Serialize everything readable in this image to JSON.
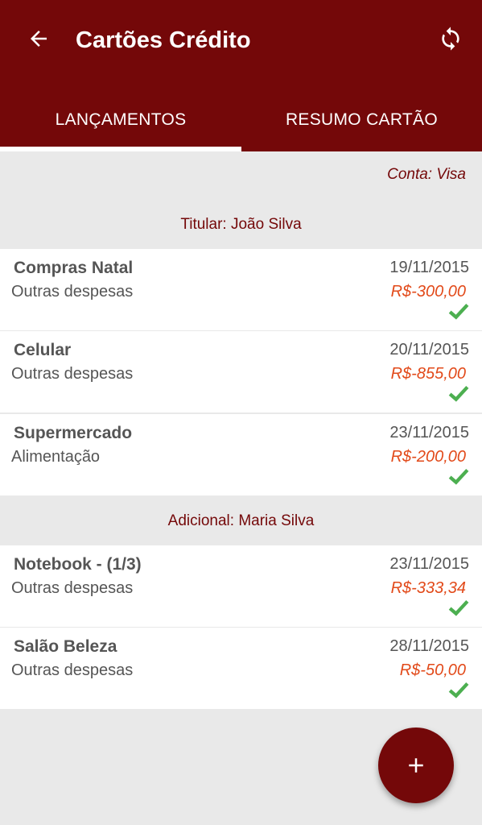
{
  "appbar": {
    "title": "Cartões Crédito",
    "back_icon": "arrow-back-icon",
    "sync_icon": "sync-icon"
  },
  "tabs": [
    {
      "label": "LANÇAMENTOS",
      "active": true
    },
    {
      "label": "RESUMO CARTÃO",
      "active": false
    }
  ],
  "account": "Conta: Visa",
  "groups": [
    {
      "header": "Titular: João Silva",
      "items": [
        {
          "name": "Compras Natal",
          "category": "Outras despesas",
          "date": "19/11/2015",
          "amount": "R$-300,00",
          "status_icon": "check-icon"
        },
        {
          "name": "Celular",
          "category": "Outras despesas",
          "date": "20/11/2015",
          "amount": "R$-855,00",
          "status_icon": "check-icon"
        },
        {
          "name": "Supermercado",
          "category": "Alimentação",
          "date": "23/11/2015",
          "amount": "R$-200,00",
          "status_icon": "check-icon"
        }
      ]
    },
    {
      "header": "Adicional: Maria Silva",
      "items": [
        {
          "name": "Notebook - (1/3)",
          "category": "Outras despesas",
          "date": "23/11/2015",
          "amount": "R$-333,34",
          "status_icon": "check-icon"
        },
        {
          "name": "Salão Beleza",
          "category": "Outras despesas",
          "date": "28/11/2015",
          "amount": "R$-50,00",
          "status_icon": "check-icon"
        }
      ]
    }
  ],
  "fab": {
    "icon": "add-icon"
  },
  "colors": {
    "primary": "#740809",
    "amount": "#e24a1a",
    "check": "#4caf50",
    "background": "#e9e9e9"
  }
}
